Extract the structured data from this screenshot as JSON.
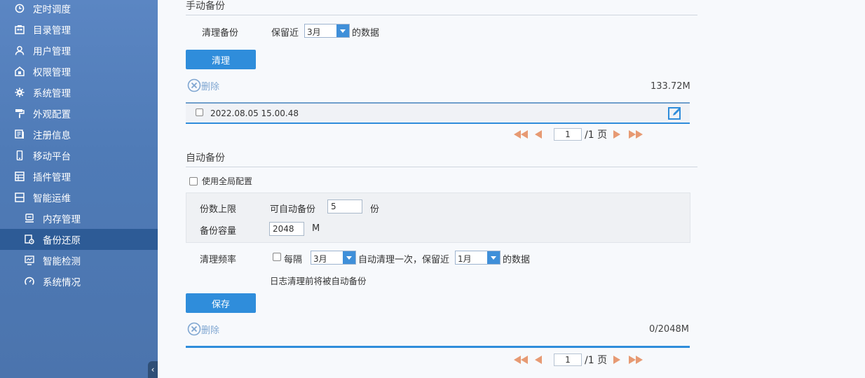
{
  "sidebar": {
    "items": [
      {
        "label": "定时调度",
        "icon": "clock-icon"
      },
      {
        "label": "目录管理",
        "icon": "folder-grid-icon"
      },
      {
        "label": "用户管理",
        "icon": "user-icon"
      },
      {
        "label": "权限管理",
        "icon": "permission-icon"
      },
      {
        "label": "系统管理",
        "icon": "gear-icon"
      },
      {
        "label": "外观配置",
        "icon": "paint-roller-icon"
      },
      {
        "label": "注册信息",
        "icon": "register-icon"
      },
      {
        "label": "移动平台",
        "icon": "mobile-icon"
      },
      {
        "label": "插件管理",
        "icon": "plugin-icon"
      },
      {
        "label": "智能运维",
        "icon": "ops-icon"
      }
    ],
    "sub_items": [
      {
        "label": "内存管理",
        "icon": "memory-icon"
      },
      {
        "label": "备份还原",
        "icon": "backup-icon",
        "active": true
      },
      {
        "label": "智能检测",
        "icon": "monitor-icon"
      },
      {
        "label": "系统情况",
        "icon": "gauge-icon"
      }
    ],
    "collapse_glyph": "‹"
  },
  "manual": {
    "title": "手动备份",
    "clean_label": "清理备份",
    "keep_prefix": "保留近",
    "keep_value": "3月",
    "keep_suffix": "的数据",
    "clean_button": "清理",
    "delete_label": "删除",
    "total_size": "133.72M",
    "backups": [
      {
        "name": "2022.08.05 15.00.48"
      }
    ],
    "page_value": "1",
    "page_total": "/1 页"
  },
  "auto": {
    "title": "自动备份",
    "use_global": "使用全局配置",
    "count_label": "份数上限",
    "count_prefix": "可自动备份",
    "count_value": "5",
    "count_unit": "份",
    "capacity_label": "备份容量",
    "capacity_value": "2048",
    "capacity_unit": "M",
    "freq_label": "清理频率",
    "every": "每隔",
    "every_value": "3月",
    "auto_clean_text": "自动清理一次，保留近",
    "keep_value": "1月",
    "keep_suffix": "的数据",
    "note": "日志清理前将被自动备份",
    "save_button": "保存",
    "delete_label": "删除",
    "usage": "0/2048M",
    "page_value": "1",
    "page_total": "/1 页"
  },
  "colors": {
    "accent": "#2f8ddb",
    "sidebar": "#5b86c3",
    "pager_arrow": "#e79a73"
  }
}
